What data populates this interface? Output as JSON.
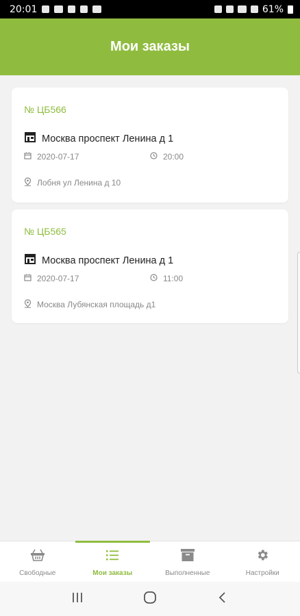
{
  "status_bar": {
    "time": "20:01",
    "battery": "61%"
  },
  "header": {
    "title": "Мои заказы"
  },
  "orders": [
    {
      "number": "№ ЦБ566",
      "store": "Москва проспект Ленина д 1",
      "date": "2020-07-17",
      "time": "20:00",
      "address": "Лобня ул Ленина д 10"
    },
    {
      "number": "№ ЦБ565",
      "store": "Москва проспект Ленина д 1",
      "date": "2020-07-17",
      "time": "11:00",
      "address": "Москва Лубянская площадь д1"
    }
  ],
  "bottom_nav": {
    "items": [
      {
        "label": "Свободные",
        "icon": "basket-icon"
      },
      {
        "label": "Мои заказы",
        "icon": "list-icon",
        "active": true
      },
      {
        "label": "Выполненные",
        "icon": "archive-icon"
      },
      {
        "label": "Настройки",
        "icon": "gear-icon"
      }
    ]
  },
  "colors": {
    "accent": "#8fbc3f",
    "background": "#f2f2f2",
    "muted": "#888888"
  }
}
